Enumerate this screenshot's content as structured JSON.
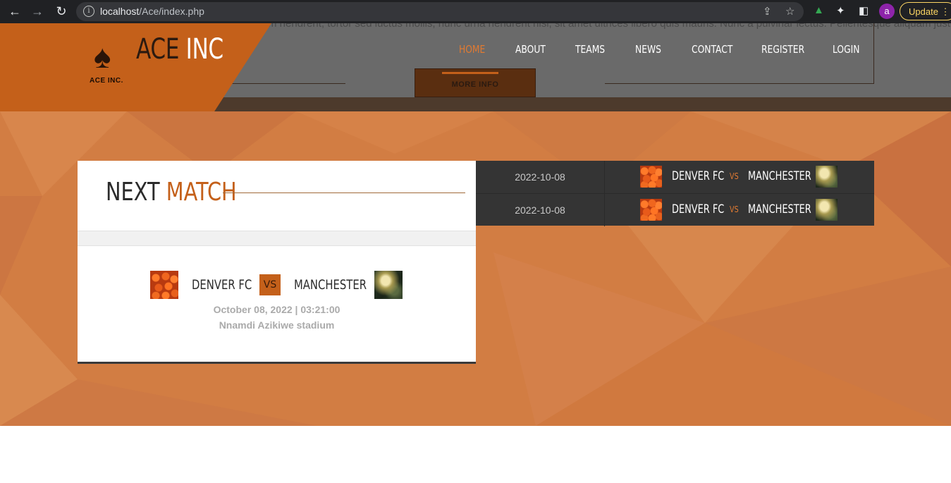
{
  "browser": {
    "url_host": "localhost",
    "url_path": "/Ace/index.php",
    "profile_initial": "a",
    "update_label": "Update"
  },
  "header": {
    "background_text": "...ipsum hendrerit, tortor sed luctus mollis, nunc urna hendrerit nisl, sit amet ultrices libero quis mauris. Nunc a pulvinar lectus. Pellentesque aliquam justo ut rhoncus lobortis. In sed",
    "more_info_label": "MORE INFO",
    "logo_sub": "ACE INC.",
    "brand_ace": "ACE",
    "brand_inc": "INC",
    "nav": [
      "HOME",
      "ABOUT",
      "TEAMS",
      "NEWS",
      "CONTACT",
      "REGISTER",
      "LOGIN"
    ],
    "active_nav": "HOME"
  },
  "next_match": {
    "title_part1": "NEXT",
    "title_part2": "MATCH",
    "home_team": "DENVER FC",
    "vs": "VS",
    "away_team": "MANCHESTER",
    "datetime": "October 08, 2022 | 03:21:00",
    "venue": "Nnamdi Azikiwe stadium"
  },
  "results": [
    {
      "date": "2022-10-08",
      "home": "DENVER FC",
      "vs": "VS",
      "away": "MANCHESTER"
    },
    {
      "date": "2022-10-08",
      "home": "DENVER FC",
      "vs": "VS",
      "away": "MANCHESTER"
    }
  ],
  "colors": {
    "accent": "#c4601a",
    "section_bg": "#d27d43",
    "results_bg": "#343434"
  }
}
